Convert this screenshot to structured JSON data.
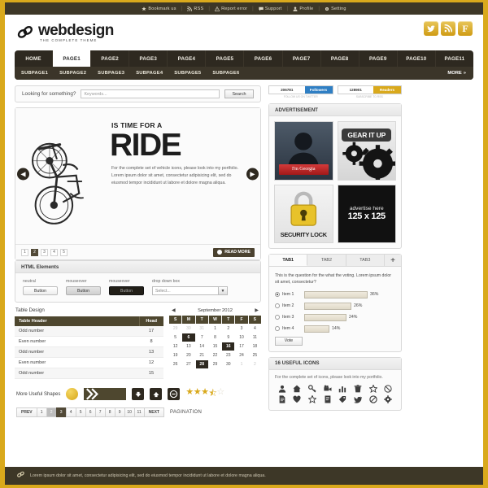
{
  "theme": {
    "accent_gold": "#d9a91c",
    "dark_brown": "#3d3727",
    "nav_dark": "#2e2920",
    "table_header": "#4e472f"
  },
  "topbar": {
    "items": [
      {
        "icon": "star-icon",
        "label": "Bookmark us"
      },
      {
        "icon": "rss-icon",
        "label": "RSS"
      },
      {
        "icon": "warning-icon",
        "label": "Report error"
      },
      {
        "icon": "comment-icon",
        "label": "Support"
      },
      {
        "icon": "user-icon",
        "label": "Profile"
      },
      {
        "icon": "gear-icon",
        "label": "Setting"
      }
    ],
    "separator": "|"
  },
  "header": {
    "logo_name": "webdesign",
    "logo_tagline": "THE COMPLETE THEME",
    "social": [
      {
        "name": "twitter-icon",
        "glyph": "🕊"
      },
      {
        "name": "rss-icon",
        "glyph": "◔"
      },
      {
        "name": "facebook-icon",
        "glyph": "F"
      }
    ]
  },
  "nav": {
    "primary": [
      {
        "label": "HOME",
        "active": false
      },
      {
        "label": "PAGE1",
        "active": true
      },
      {
        "label": "PAGE2",
        "active": false
      },
      {
        "label": "PAGE3",
        "active": false
      },
      {
        "label": "PAGE4",
        "active": false
      },
      {
        "label": "PAGE5",
        "active": false
      },
      {
        "label": "PAGE6",
        "active": false
      },
      {
        "label": "PAGE7",
        "active": false
      },
      {
        "label": "PAGE8",
        "active": false
      },
      {
        "label": "PAGE9",
        "active": false
      },
      {
        "label": "PAGE10",
        "active": false
      },
      {
        "label": "PAGE11",
        "active": false
      }
    ],
    "secondary": [
      "SUBPAGE1",
      "SUBPAGE2",
      "SUBPAGE3",
      "SUBPAGE4",
      "SUBPAGE5",
      "SUBPAGE6"
    ],
    "more_label": "MORE",
    "more_glyph": "»"
  },
  "search": {
    "label": "Looking for something?",
    "placeholder": "Keywords...",
    "value": "",
    "button": "Search"
  },
  "slider": {
    "kicker": "IS TIME FOR A",
    "title": "RIDE",
    "description": "For the complete set of vehicle icons, please look into my portfolio. Lorem ipsum dolor sit amet, consectetur adipisicing elit, sed do eiusmod tempor incididunt ut labore et dolore magna aliqua.",
    "prev_glyph": "◀",
    "next_glyph": "▶",
    "dots": [
      "1",
      "2",
      "3",
      "4",
      "5"
    ],
    "active_dot": "2",
    "read_more": "READ MORE",
    "image_alt": "motorcycle-illustration"
  },
  "html_elements": {
    "heading": "HTML Elements",
    "buttons": [
      {
        "state_label": "neutral",
        "label": "Button"
      },
      {
        "state_label": "mouseover",
        "label": "Button"
      },
      {
        "state_label": "mouseover",
        "label": "Button"
      }
    ],
    "dropdown": {
      "label": "drop down box",
      "value": "Select...",
      "arrow": "▼"
    }
  },
  "table": {
    "caption": "Table Design",
    "columns": [
      "Table Header",
      "Head"
    ],
    "rows": [
      {
        "name": "Odd number",
        "value": "17"
      },
      {
        "name": "Even number",
        "value": "8"
      },
      {
        "name": "Odd number",
        "value": "13"
      },
      {
        "name": "Even number",
        "value": "12"
      },
      {
        "name": "Odd number",
        "value": "15"
      }
    ]
  },
  "calendar": {
    "title": "September 2012",
    "prev_glyph": "◀",
    "next_glyph": "▶",
    "dow": [
      "S",
      "M",
      "T",
      "W",
      "T",
      "F",
      "S"
    ],
    "weeks": [
      [
        {
          "d": "29",
          "m": true
        },
        {
          "d": "30",
          "m": true
        },
        {
          "d": "31",
          "m": true
        },
        {
          "d": "1"
        },
        {
          "d": "2"
        },
        {
          "d": "3"
        },
        {
          "d": "4"
        }
      ],
      [
        {
          "d": "5"
        },
        {
          "d": "6",
          "s": true
        },
        {
          "d": "7"
        },
        {
          "d": "8"
        },
        {
          "d": "9"
        },
        {
          "d": "10"
        },
        {
          "d": "11"
        }
      ],
      [
        {
          "d": "12"
        },
        {
          "d": "13"
        },
        {
          "d": "14"
        },
        {
          "d": "15"
        },
        {
          "d": "16",
          "s": true
        },
        {
          "d": "17"
        },
        {
          "d": "18"
        }
      ],
      [
        {
          "d": "19"
        },
        {
          "d": "20"
        },
        {
          "d": "21"
        },
        {
          "d": "22"
        },
        {
          "d": "23"
        },
        {
          "d": "24"
        },
        {
          "d": "25"
        }
      ],
      [
        {
          "d": "26"
        },
        {
          "d": "27"
        },
        {
          "d": "28",
          "s": true
        },
        {
          "d": "29"
        },
        {
          "d": "30"
        },
        {
          "d": "1",
          "m": true
        },
        {
          "d": "2",
          "m": true
        }
      ]
    ]
  },
  "shapes": {
    "label": "More Useful Shapes",
    "down_glyph": "⬇",
    "up_glyph": "⬆",
    "minus_glyph": "⊖",
    "rating": 3.5,
    "stars": [
      "★",
      "★",
      "★",
      "⯪",
      "☆"
    ]
  },
  "pagination": {
    "prev": "PREV",
    "next": "NEXT",
    "pages": [
      "1",
      "2",
      "3",
      "4",
      "5",
      "6",
      "7",
      "8",
      "9",
      "10",
      "11"
    ],
    "active": "3",
    "hover": "2",
    "label": "PAGINATION"
  },
  "counters": [
    {
      "count": "206781",
      "tag": "Followers",
      "sub": "FOLLOW US ON TWITTER"
    },
    {
      "count": "128901",
      "tag": "Readers",
      "sub": "SUBSCRIBE TO RSS"
    }
  ],
  "advertisement": {
    "heading": "ADVERTISEMENT",
    "ads": [
      {
        "name": "im-georgia-ad",
        "button": "I'm Georgia"
      },
      {
        "name": "gear-it-up-ad",
        "label": "GEAR IT UP"
      },
      {
        "name": "security-lock-ad",
        "label": "SECURITY LOCK"
      },
      {
        "name": "advertise-here-ad",
        "line1": "advertise here",
        "line2": "125 x 125"
      }
    ]
  },
  "tabs_widget": {
    "tabs": [
      {
        "label": "TAB1",
        "active": true
      },
      {
        "label": "TAB2",
        "active": false
      },
      {
        "label": "TAB3",
        "active": false
      }
    ],
    "add_glyph": "+",
    "question": "This is the question for the what the voting. Lorem ipsum dolor sit amet, consectetur?",
    "options": [
      {
        "label": "Item 1",
        "percent": "36%",
        "value": 36,
        "selected": true
      },
      {
        "label": "Item 2",
        "percent": "26%",
        "value": 26,
        "selected": false
      },
      {
        "label": "Item 3",
        "percent": "24%",
        "value": 24,
        "selected": false
      },
      {
        "label": "Item 4",
        "percent": "14%",
        "value": 14,
        "selected": false
      }
    ],
    "vote_button": "Vote"
  },
  "icons_widget": {
    "heading": "16 USEFUL ICONS",
    "description": "For the complete set of icons, please look into my portfolio.",
    "icons": [
      {
        "name": "user-icon",
        "glyph": "👤"
      },
      {
        "name": "home-icon",
        "glyph": "🏠"
      },
      {
        "name": "key-icon",
        "glyph": "🔑"
      },
      {
        "name": "video-camera-icon",
        "glyph": "🎥"
      },
      {
        "name": "bar-chart-icon",
        "glyph": "📊"
      },
      {
        "name": "trash-icon",
        "glyph": "🗑"
      },
      {
        "name": "star-icon",
        "glyph": "☆"
      },
      {
        "name": "no-entry-icon",
        "glyph": "🚫"
      },
      {
        "name": "document-icon",
        "glyph": "📄"
      },
      {
        "name": "heart-icon",
        "glyph": "♥"
      },
      {
        "name": "star-outline-icon",
        "glyph": "☆"
      },
      {
        "name": "book-icon",
        "glyph": "📔"
      },
      {
        "name": "tag-icon",
        "glyph": "🏷"
      },
      {
        "name": "bird-icon",
        "glyph": "🕊"
      },
      {
        "name": "block-icon",
        "glyph": "⊘"
      },
      {
        "name": "gear-icon",
        "glyph": "⚙"
      }
    ]
  },
  "footer": {
    "text": "Lorem ipsum dolor sit amet, consectetur adipisicing elit, sed do eiusmod tempor incididunt ut labore et dolore magna aliqua.",
    "icon": "link-icon"
  }
}
